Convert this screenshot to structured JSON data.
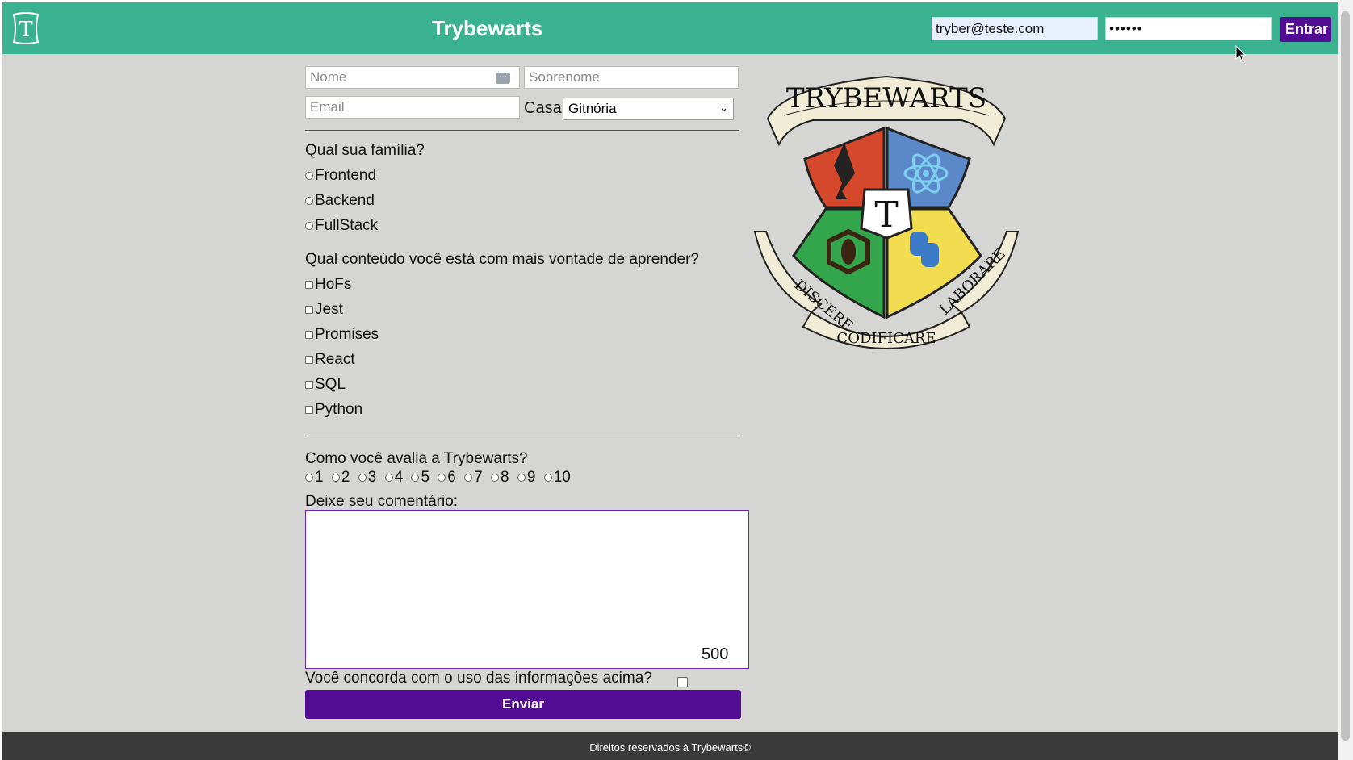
{
  "header": {
    "title": "Trybewarts",
    "logo_letter": "T",
    "login": {
      "email_value": "tryber@teste.com",
      "password_value": "••••••",
      "submit_label": "Entrar"
    }
  },
  "form": {
    "name_placeholder": "Nome",
    "lastname_placeholder": "Sobrenome",
    "email_placeholder": "Email",
    "house_label": "Casa",
    "house_selected": "Gitnória",
    "family_question": "Qual sua família?",
    "family_options": [
      "Frontend",
      "Backend",
      "FullStack"
    ],
    "content_question": "Qual conteúdo você está com mais vontade de aprender?",
    "content_options": [
      "HoFs",
      "Jest",
      "Promises",
      "React",
      "SQL",
      "Python"
    ],
    "rate_question": "Como você avalia a Trybewarts?",
    "rate_options": [
      "1",
      "2",
      "3",
      "4",
      "5",
      "6",
      "7",
      "8",
      "9",
      "10"
    ],
    "comment_label": "Deixe seu comentário:",
    "char_counter": "500",
    "agreement_label": "Você concorda com o uso das informações acima?",
    "submit_label": "Enviar"
  },
  "crest": {
    "banner_top": "TRYBEWARTS",
    "center_letter": "T",
    "motto_left": "DISCERE",
    "motto_center": "CODIFICARE",
    "motto_right": "LABORARE"
  },
  "footer": {
    "text": "Direitos reservados à Trybewarts©"
  },
  "colors": {
    "header_bg": "#3bb28f",
    "accent_purple": "#530d94",
    "page_bg": "#d5d5d3",
    "footer_bg": "#3a3a3a"
  }
}
